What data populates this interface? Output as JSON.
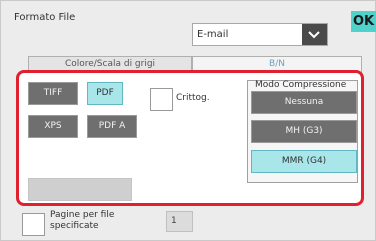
{
  "header": {
    "title": "Formato File"
  },
  "destination": {
    "value": "E-mail"
  },
  "ok_label": "OK",
  "tabs": [
    {
      "label": "Colore/Scala di grigi"
    },
    {
      "label": "B/N"
    }
  ],
  "formats": {
    "tiff": "TIFF",
    "pdf": "PDF",
    "xps": "XPS",
    "pdfa": "PDF A",
    "selected": "PDF"
  },
  "encrypt": {
    "label": "Crittog."
  },
  "compression": {
    "title": "Modo Compressione",
    "options": [
      "Nessuna",
      "MH (G3)",
      "MMR (G4)"
    ],
    "selected": "MMR (G4)"
  },
  "pages": {
    "label_line1": "Pagine per file",
    "label_line2": "specificate",
    "value": "1"
  },
  "colors": {
    "accent": "#4fd2cb",
    "selected": "#a8e6ea",
    "highlight": "#e0202e"
  }
}
